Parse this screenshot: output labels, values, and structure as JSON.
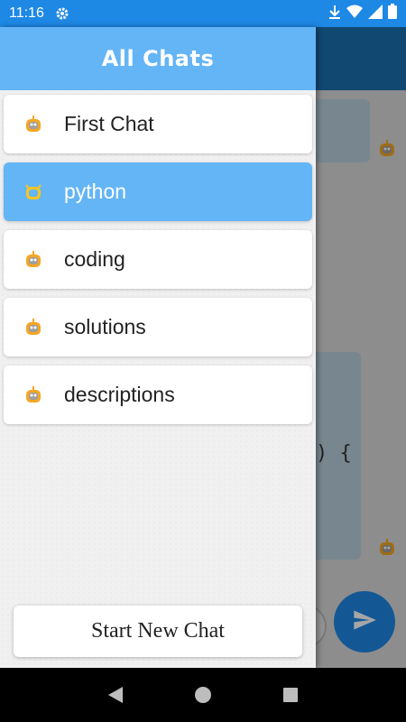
{
  "status": {
    "time": "11:16"
  },
  "drawer": {
    "title": "All Chats",
    "chats": [
      {
        "label": "First Chat",
        "active": false
      },
      {
        "label": "python",
        "active": true
      },
      {
        "label": "coding",
        "active": false
      },
      {
        "label": "solutions",
        "active": false
      },
      {
        "label": "descriptions",
        "active": false
      }
    ],
    "new_chat_label": "Start New Chat"
  },
  "background": {
    "code_snippet": ") {"
  },
  "colors": {
    "accent": "#64b5f6",
    "status_bar": "#1e88e5",
    "app_bar": "#1b6fb0"
  },
  "icons": {
    "chat_avatar": "robot-icon",
    "send": "send-icon"
  }
}
